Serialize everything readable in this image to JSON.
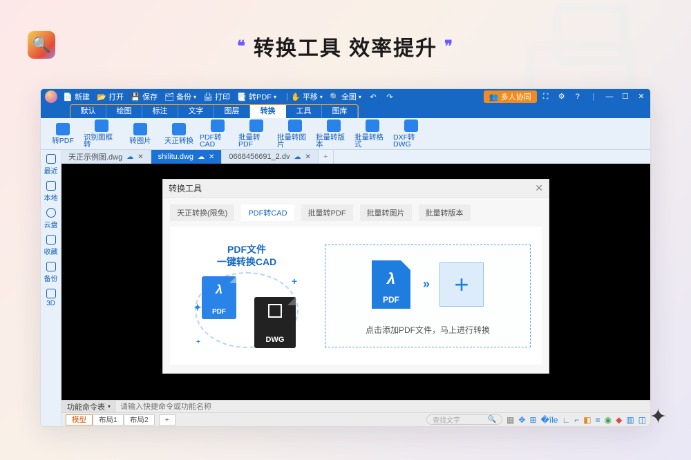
{
  "banner": {
    "title": "转换工具 效率提升"
  },
  "titlebar": {
    "items": [
      "新建",
      "打开",
      "保存",
      "备份",
      "打印",
      "转PDF",
      "平移",
      "全图"
    ],
    "collab_btn": "多人协同"
  },
  "ribbon": {
    "tabs": [
      "默认",
      "绘图",
      "标注",
      "文字",
      "图层",
      "转换",
      "工具",
      "图库"
    ],
    "active_index": 5
  },
  "toolbar": [
    "转PDF",
    "识别图框转",
    "转图片",
    "天正转换",
    "PDF转CAD",
    "批量转PDF",
    "批量转图片",
    "批量转版本",
    "批量转格式",
    "DXF转DWG"
  ],
  "sidebar": [
    {
      "icon": "recent",
      "label": "最近"
    },
    {
      "icon": "local",
      "label": "本地"
    },
    {
      "icon": "cloud",
      "label": "云盘"
    },
    {
      "icon": "fav",
      "label": "收藏"
    },
    {
      "icon": "backup",
      "label": "备份"
    },
    {
      "icon": "3d",
      "label": "3D"
    }
  ],
  "doc_tabs": [
    {
      "label": "天正示例图.dwg",
      "active": false
    },
    {
      "label": "shilitu.dwg",
      "active": true
    },
    {
      "label": "0668456691_2.dv",
      "active": false
    }
  ],
  "dialog": {
    "title": "转换工具",
    "tabs": [
      "天正转换(限免)",
      "PDF转CAD",
      "批量转PDF",
      "批量转图片",
      "批量转版本"
    ],
    "active_index": 1,
    "promo_line1": "PDF文件",
    "promo_line2": "一键转换CAD",
    "pdf_label": "PDF",
    "dwg_label": "DWG",
    "dz_pdf": "PDF",
    "dz_hint": "点击添加PDF文件，马上进行转换"
  },
  "cmdline": {
    "label": "功能命令表",
    "placeholder": "请输入快捷命令或功能名称"
  },
  "status": {
    "tabs": [
      "模型",
      "布局1",
      "布局2"
    ],
    "active_index": 0,
    "search_placeholder": "查找文字"
  }
}
